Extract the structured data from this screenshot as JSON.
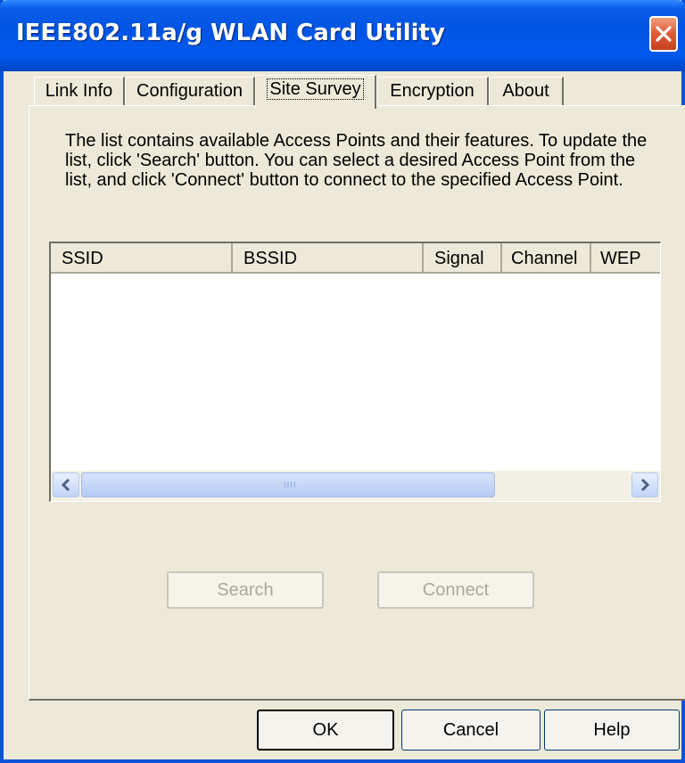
{
  "window": {
    "title": "IEEE802.11a/g WLAN Card Utility"
  },
  "tabs": [
    {
      "label": "Link Info"
    },
    {
      "label": "Configuration"
    },
    {
      "label": "Site Survey",
      "active": true
    },
    {
      "label": "Encryption"
    },
    {
      "label": "About"
    }
  ],
  "site_survey": {
    "description": "The list contains available Access Points and their features. To update the list, click 'Search' button. You can select a desired Access Point from the list, and click 'Connect' button to connect to the specified Access Point.",
    "columns": [
      "SSID",
      "BSSID",
      "Signal",
      "Channel",
      "WEP"
    ],
    "rows": [],
    "search_label": "Search",
    "connect_label": "Connect"
  },
  "footer": {
    "ok_label": "OK",
    "cancel_label": "Cancel",
    "help_label": "Help"
  },
  "icons": {
    "close": "close-icon",
    "scroll_left": "chevron-left-icon",
    "scroll_right": "chevron-right-icon"
  },
  "colors": {
    "titlebar": "#0054e3",
    "face": "#ece9d8",
    "close_button": "#e35d3a"
  }
}
